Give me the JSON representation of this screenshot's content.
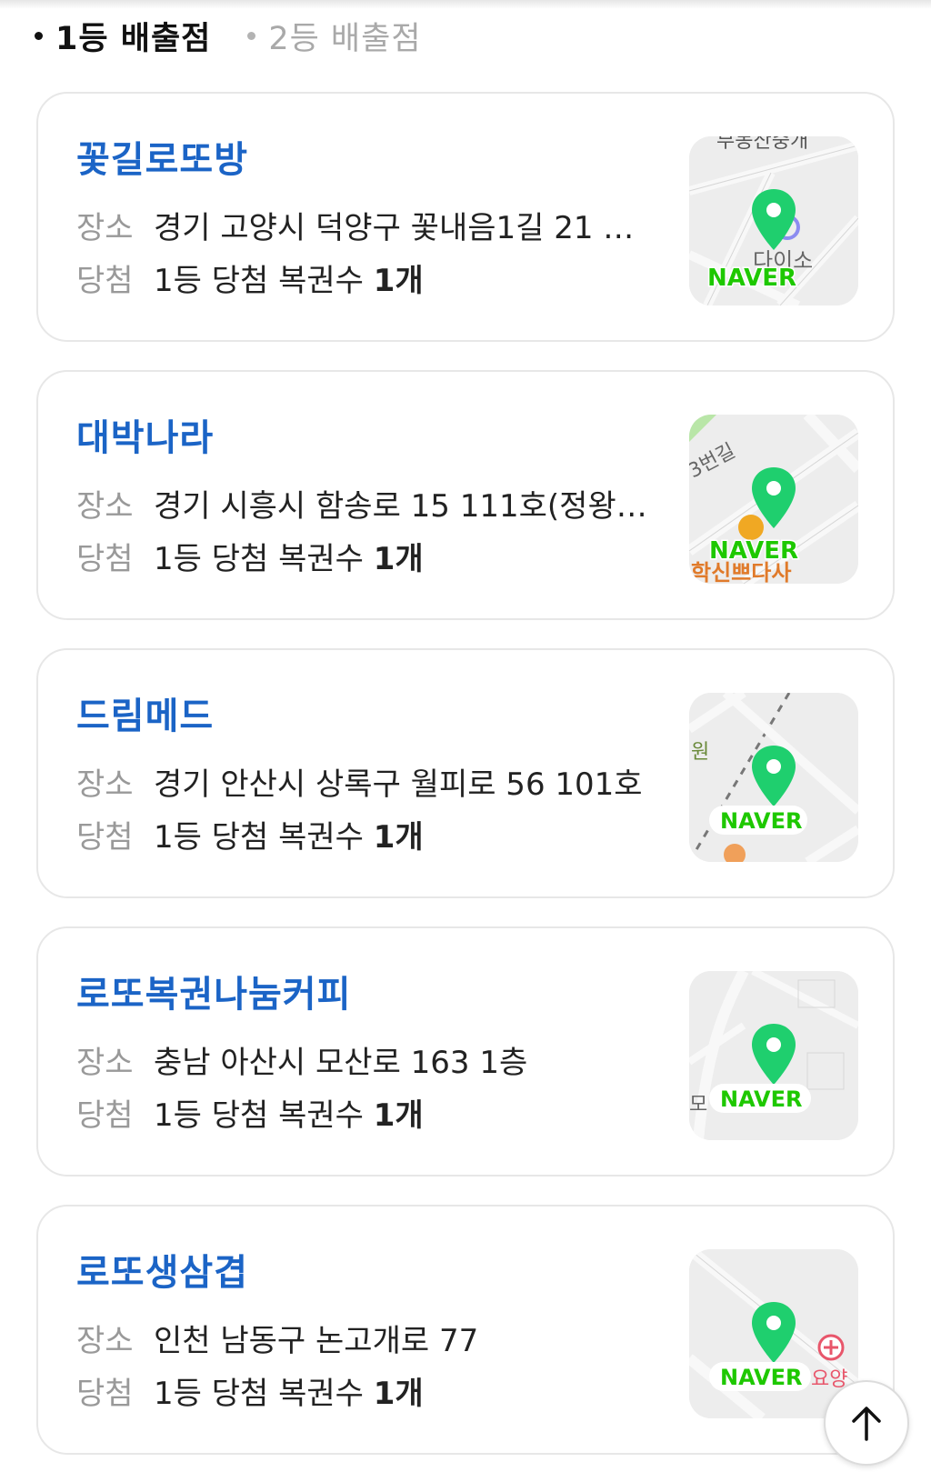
{
  "tabs": {
    "first": "1등 배출점",
    "second": "2등 배출점"
  },
  "labels": {
    "place": "장소",
    "win": "당첨"
  },
  "stores": [
    {
      "name": "꽃길로또방",
      "address": "경기 고양시 덕양구 꽃내음1길 21 …",
      "win_text": "1등 당첨 복권수",
      "win_count": "1개",
      "map_text": "부동산중개",
      "map_text2": "다이소"
    },
    {
      "name": "대박나라",
      "address": "경기 시흥시 함송로 15 111호(정왕…",
      "win_text": "1등 당첨 복권수",
      "win_count": "1개",
      "map_text": "3번길",
      "map_text2": "학신쁘다사"
    },
    {
      "name": "드림메드",
      "address": "경기 안산시 상록구 월피로 56 101호",
      "win_text": "1등 당첨 복권수",
      "win_count": "1개",
      "map_text": "원",
      "map_text2": ""
    },
    {
      "name": "로또복권나눔커피",
      "address": "충남 아산시 모산로 163 1층",
      "win_text": "1등 당첨 복권수",
      "win_count": "1개",
      "map_text": "모",
      "map_text2": ""
    },
    {
      "name": "로또생삼겹",
      "address": "인천 남동구 논고개로 77",
      "win_text": "1등 당첨 복권수",
      "win_count": "1개",
      "map_text": "요양",
      "map_text2": ""
    }
  ],
  "map_brand": "NAVER",
  "colors": {
    "name": "#1b64c6",
    "pin": "#1fcf6e",
    "naver": "#1ec800"
  }
}
